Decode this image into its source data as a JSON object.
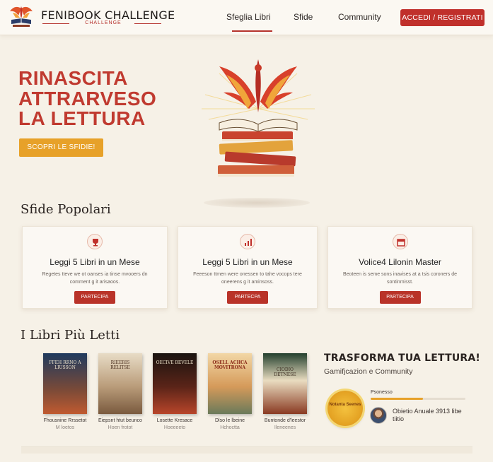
{
  "header": {
    "brand": "FENIBOOK CHALLENGE",
    "brand_sub": "CHALLENGE",
    "nav": [
      "Sfeglia Libri",
      "Sfide",
      "Community"
    ],
    "login": "ACCEDI / REGISTRATI"
  },
  "hero": {
    "title_lines": [
      "RINASCITA",
      "ATTRARVESO",
      "LA LETTURA"
    ],
    "cta": "SCOPRI LE SFIDIE!"
  },
  "challenges": {
    "title": "Sfide Popolari",
    "cards": [
      {
        "title": "Leggi 5 Libri in un Mese",
        "desc": "Regetes tteve we ot oanses ia tinse mvooers dn comment g it arisaoos.",
        "button": "PARTECIPA",
        "icon": "trophy-icon"
      },
      {
        "title": "Leggi 5 Libri in un Mese",
        "desc": "Feeeson ttmen were onessen to tahe vocops tere oneerens g it aminsoss.",
        "button": "PARTECPA",
        "icon": "chart-icon"
      },
      {
        "title": "Volice4 Lilonin Master",
        "desc": "Beoteen is seme sons inavises at a tsis coroners de sontinmisst.",
        "button": "PARTECIPA",
        "icon": "calendar-icon"
      }
    ]
  },
  "books": {
    "title": "I Libri Più Letti",
    "items": [
      {
        "cover": "FFEH RRNO A LIUSSON",
        "title": "Fhousnine Rrssetot",
        "author": "M loetos"
      },
      {
        "cover": "RIEERIS RELITSE",
        "title": "Eiepsnt htut beunco",
        "author": "Hoen frotot"
      },
      {
        "cover": "OECIVE BEVELE",
        "title": "Losette Kresace",
        "author": "Hoeeeeto"
      },
      {
        "cover": "OSELL ACHCA MOVITRONA",
        "title": "Dlso le lbeine",
        "author": "Hchoctta"
      },
      {
        "cover": "CIODIO DETNESE",
        "title": "Buntonde d'leestor",
        "author": "Ileneenes"
      }
    ]
  },
  "promo": {
    "title": "TRASFORMA TUA LETTURA!",
    "subtitle": "Gamifjcazion e Community",
    "badge": "Notanta Seenes",
    "progress_label": "Psonesso",
    "progress": 0.55,
    "goal": "Obietio Anuale 3913 libe tiitio"
  },
  "colors": {
    "accent": "#c0302b",
    "gold": "#e7a129",
    "background": "#f6f1e7"
  }
}
